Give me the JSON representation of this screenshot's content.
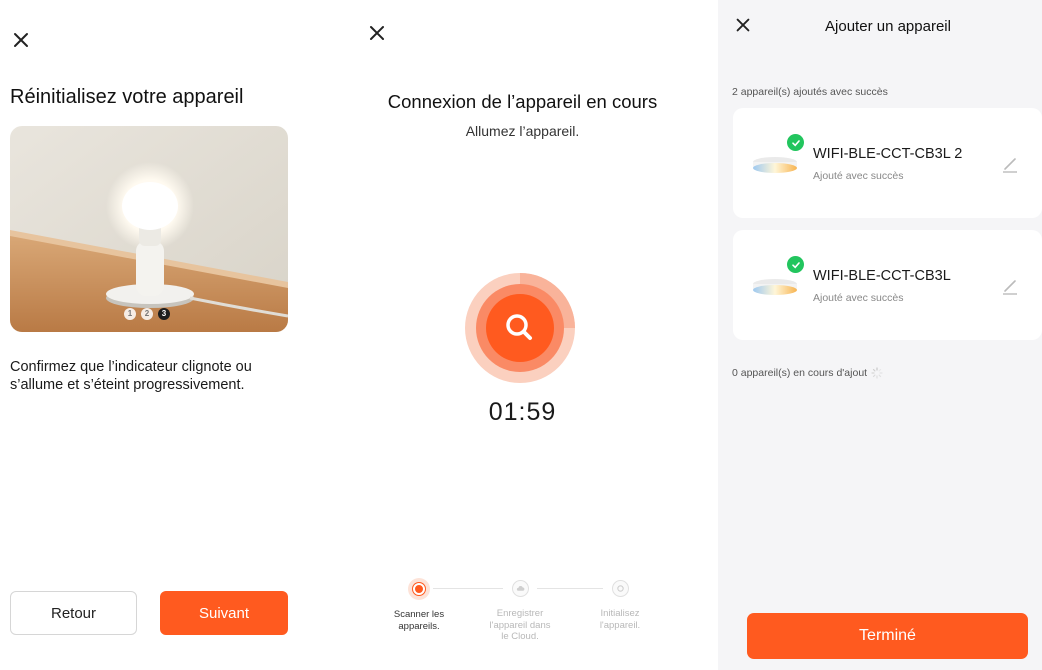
{
  "screen1": {
    "title": "Réinitialisez votre appareil",
    "image_steps": [
      "1",
      "2",
      "3"
    ],
    "image_active_step": 3,
    "instructions": "Confirmez que l’indicateur clignote ou s’allume et s’éteint progressivement.",
    "back_label": "Retour",
    "next_label": "Suivant"
  },
  "screen2": {
    "title": "Connexion de l’appareil en cours",
    "subtitle": "Allumez l’appareil.",
    "timer": "01:59",
    "steps": [
      {
        "label": "Scanner les appareils.",
        "state": "active"
      },
      {
        "label": "Enregistrer l'appareil dans le Cloud.",
        "state": "pending"
      },
      {
        "label": "Initialisez l'appareil.",
        "state": "pending"
      }
    ]
  },
  "screen3": {
    "title": "Ajouter un appareil",
    "success_count": "2 appareil(s) ajoutés avec succès",
    "devices": [
      {
        "name": "WIFI-BLE-CCT-CB3L 2",
        "status": "Ajouté avec succès"
      },
      {
        "name": "WIFI-BLE-CCT-CB3L",
        "status": "Ajouté avec succès"
      }
    ],
    "pending_count": "0 appareil(s) en cours d'ajout",
    "done_label": "Terminé"
  },
  "colors": {
    "accent": "#ff5a1f",
    "success": "#22c55e",
    "background_secondary": "#f5f5f7"
  },
  "icons": {
    "close": "close-icon",
    "search": "search-icon",
    "check": "check-icon",
    "edit": "pencil-icon",
    "spinner": "loading-spinner-icon",
    "lamp": "ceiling-lamp-icon"
  }
}
